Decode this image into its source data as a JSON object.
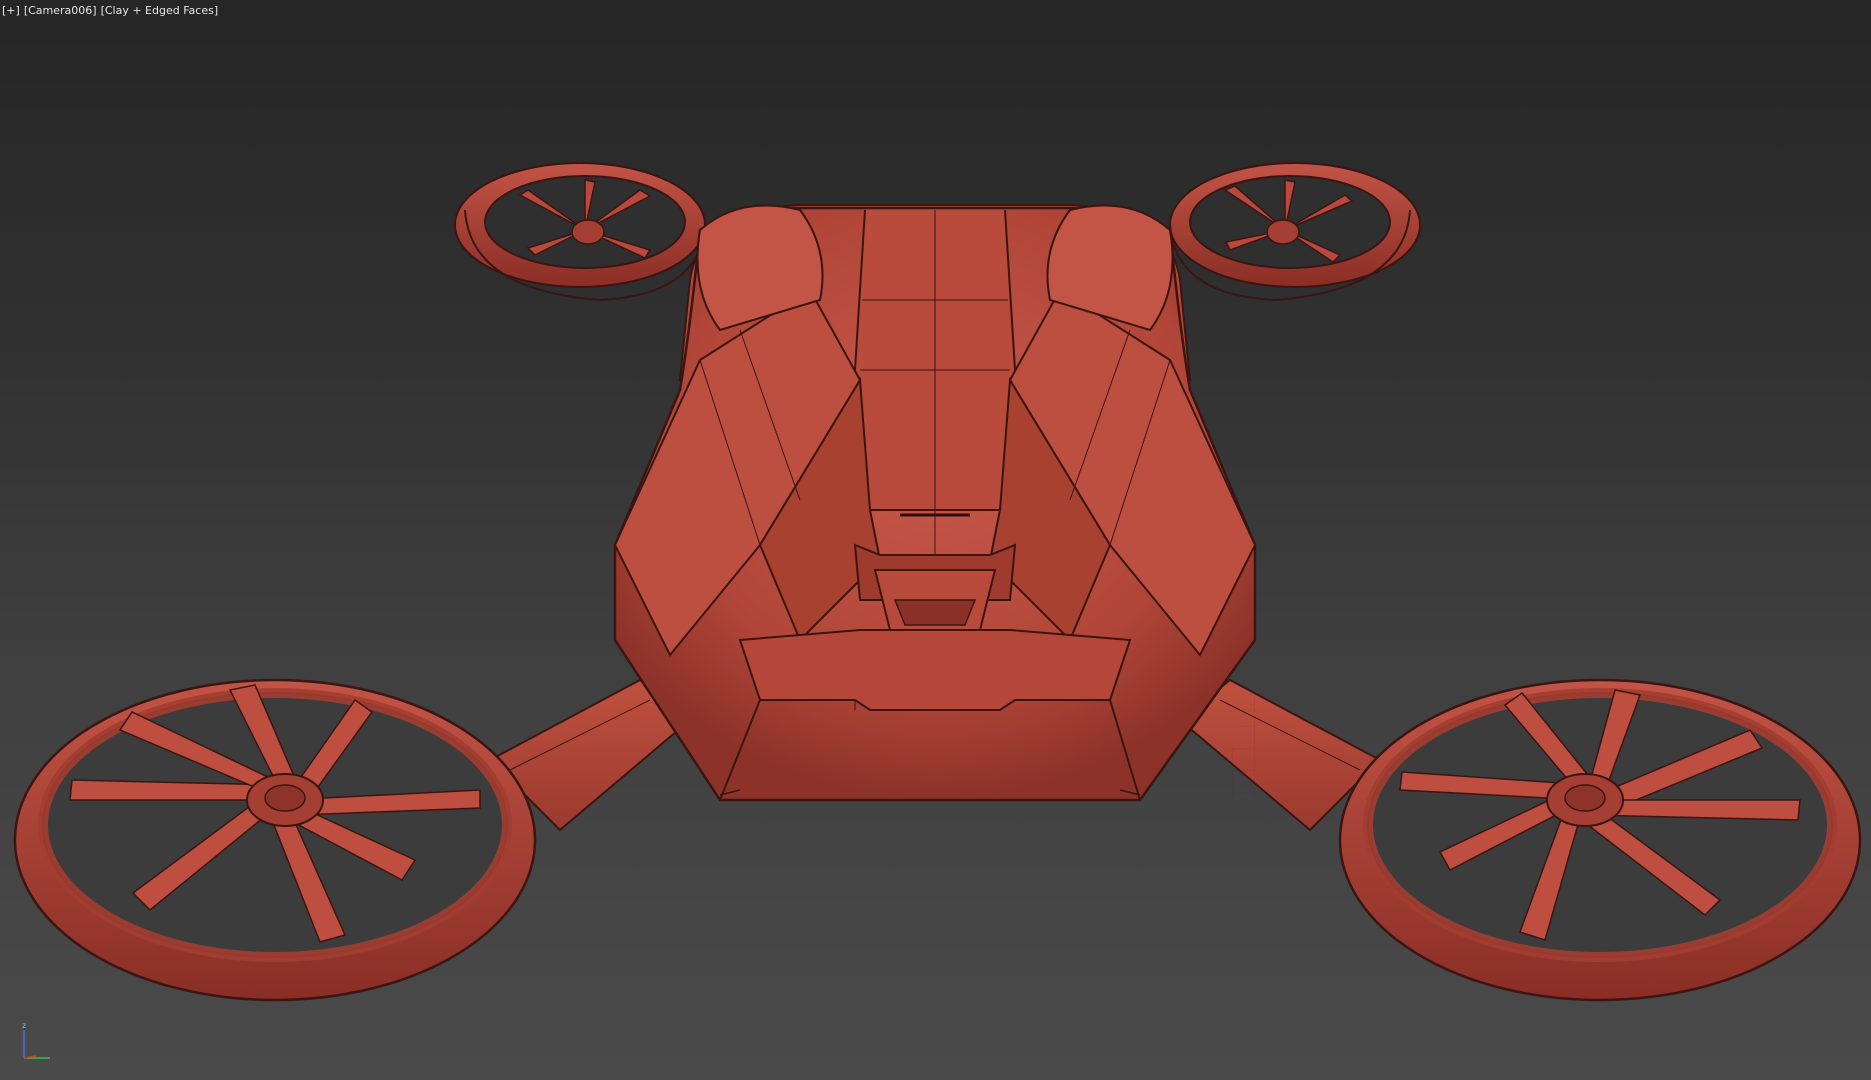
{
  "viewport": {
    "menu_label": "[+]",
    "camera_label": "[Camera006]",
    "shading_label": "[Clay + Edged Faces]"
  },
  "gizmo": {
    "z_label": "z"
  },
  "colors": {
    "clay": "#b5473a",
    "clay_light": "#c9584a",
    "clay_dark": "#7a2a22",
    "edge": "#3a1512",
    "background_top": "#262626",
    "background_bottom": "#4a4a4a",
    "axis_x": "#d8342c",
    "axis_y": "#3bc23b",
    "axis_z": "#4a6ee8"
  }
}
